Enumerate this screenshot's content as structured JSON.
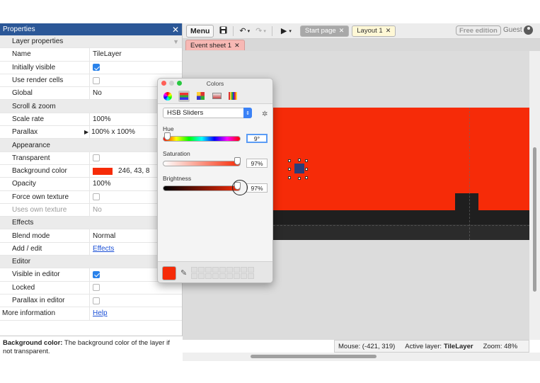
{
  "properties": {
    "title": "Properties",
    "close": "✕",
    "rows": [
      {
        "type": "section",
        "key": "Layer properties"
      },
      {
        "type": "text",
        "key": "Name",
        "value": "TileLayer"
      },
      {
        "type": "check",
        "key": "Initially visible",
        "checked": true
      },
      {
        "type": "check",
        "key": "Use render cells",
        "checked": false
      },
      {
        "type": "text",
        "key": "Global",
        "value": "No"
      },
      {
        "type": "section",
        "key": "Scroll & zoom"
      },
      {
        "type": "text",
        "key": "Scale rate",
        "value": "100%"
      },
      {
        "type": "expand",
        "key": "Parallax",
        "value": "100% x 100%"
      },
      {
        "type": "section",
        "key": "Appearance"
      },
      {
        "type": "check",
        "key": "Transparent",
        "checked": false
      },
      {
        "type": "color",
        "key": "Background color",
        "value": "246, 43, 8",
        "color": "#f62b08"
      },
      {
        "type": "text",
        "key": "Opacity",
        "value": "100%"
      },
      {
        "type": "check",
        "key": "Force own texture",
        "checked": false
      },
      {
        "type": "text",
        "key": "Uses own texture",
        "value": "No",
        "dim": true
      },
      {
        "type": "section",
        "key": "Effects"
      },
      {
        "type": "text",
        "key": "Blend mode",
        "value": "Normal"
      },
      {
        "type": "link",
        "key": "Add / edit",
        "value": "Effects"
      },
      {
        "type": "section",
        "key": "Editor"
      },
      {
        "type": "check",
        "key": "Visible in editor",
        "checked": true
      },
      {
        "type": "check",
        "key": "Locked",
        "checked": false
      },
      {
        "type": "check",
        "key": "Parallax in editor",
        "checked": false
      },
      {
        "type": "link",
        "key": "More information",
        "value": "Help",
        "top": true
      }
    ],
    "description": {
      "label": "Background color:",
      "text": " The background color of the layer if not transparent."
    }
  },
  "toolbar": {
    "menu_label": "Menu",
    "tabs": [
      "Start page",
      "Layout 1"
    ],
    "free_edition": "Free edition",
    "user": "Guest"
  },
  "subtabs": {
    "event_sheet": "Event sheet 1"
  },
  "status": {
    "mouse": "Mouse: (-421, 319)",
    "active_layer_label": "Active layer:",
    "active_layer": "TileLayer",
    "zoom": "Zoom: 48%"
  },
  "colors_panel": {
    "title": "Colors",
    "mode": "HSB Sliders",
    "hue_label": "Hue",
    "hue_value": "9°",
    "saturation_label": "Saturation",
    "saturation_value": "97%",
    "brightness_label": "Brightness",
    "brightness_value": "97%",
    "current_color": "#f62b08"
  }
}
